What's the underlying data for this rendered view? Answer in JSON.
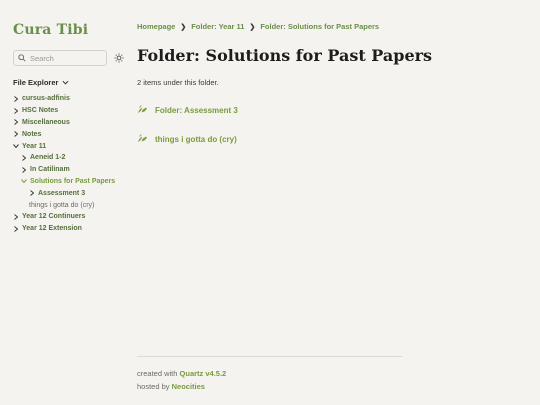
{
  "site": {
    "title": "Cura Tibi"
  },
  "search": {
    "placeholder": "Search"
  },
  "explorer": {
    "title": "File Explorer",
    "items": [
      {
        "label": "cursus-adfinis",
        "type": "folder",
        "expanded": false
      },
      {
        "label": "HSC Notes",
        "type": "folder",
        "expanded": false
      },
      {
        "label": "Miscellaneous",
        "type": "folder",
        "expanded": false
      },
      {
        "label": "Notes",
        "type": "folder",
        "expanded": false
      },
      {
        "label": "Year 11",
        "type": "folder",
        "expanded": true
      },
      {
        "label": "Aeneid 1-2",
        "type": "folder",
        "expanded": false
      },
      {
        "label": "In Catilinam",
        "type": "folder",
        "expanded": false
      },
      {
        "label": "Solutions for Past Papers",
        "type": "folder",
        "expanded": true
      },
      {
        "label": "Assessment 3",
        "type": "folder",
        "expanded": false
      },
      {
        "label": "things i gotta do (cry)",
        "type": "file"
      },
      {
        "label": "Year 12 Continuers",
        "type": "folder",
        "expanded": false
      },
      {
        "label": "Year 12 Extension",
        "type": "folder",
        "expanded": false
      }
    ]
  },
  "breadcrumb": [
    "Homepage",
    "Folder: Year 11",
    "Folder: Solutions for Past Papers"
  ],
  "page": {
    "title": "Folder: Solutions for Past Papers",
    "count_text": "2 items under this folder.",
    "entries": [
      "Folder: Assessment 3",
      "things i gotta do (cry)"
    ]
  },
  "footer": {
    "created_prefix": "created with",
    "created_link": "Quartz v4.5.2",
    "hosted_prefix": "hosted by",
    "hosted_link": "Neocities"
  },
  "colors": {
    "accent": "#7a9b3f",
    "link": "#556f3d",
    "background": "#f4f3ef",
    "title": "#6b8f4a"
  },
  "icons": [
    "search-icon",
    "sun-icon",
    "chevron-down-icon",
    "chevron-right-icon",
    "leaf-icon"
  ]
}
